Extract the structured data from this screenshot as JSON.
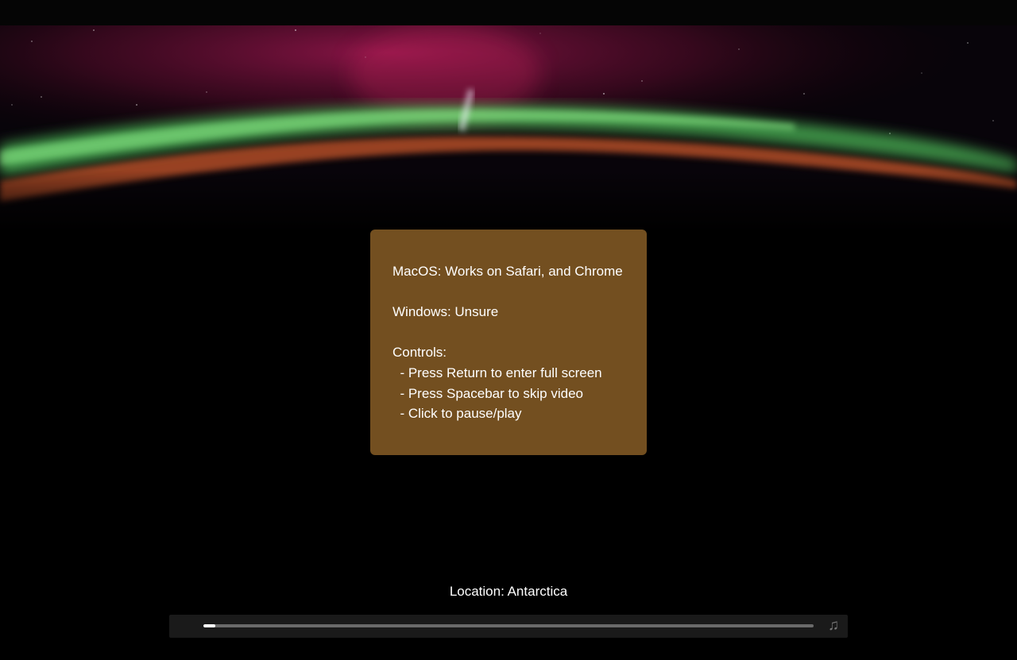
{
  "info": {
    "line1": "MacOS: Works on Safari, and Chrome",
    "line2": "Windows: Unsure",
    "line3": "Controls:",
    "line4": "  - Press Return to enter full screen",
    "line5": "  - Press Spacebar to skip video",
    "line6": "  - Click to pause/play"
  },
  "location_text": "Location: Antarctica",
  "player": {
    "progress_fraction": 0.02,
    "progress_color": "#ffffff",
    "track_color": "#6a6a6a",
    "music_icon_glyph": "♫",
    "music_icon_name": "music-note-icon"
  },
  "colors": {
    "background": "#000000",
    "info_box": "#785221",
    "aurora_green": "#5fd16a",
    "aurora_red": "#c0205a",
    "horizon_orange": "#d8602a"
  }
}
